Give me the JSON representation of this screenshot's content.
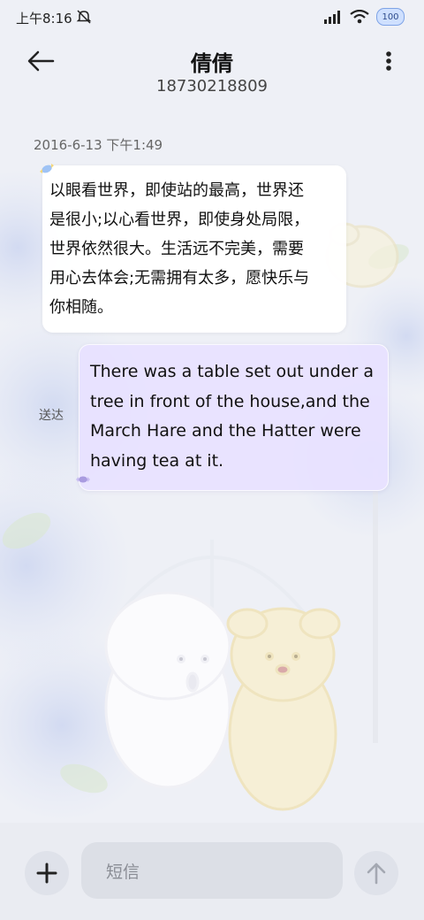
{
  "status_bar": {
    "time": "上午8:16",
    "battery_level": "100",
    "icons": [
      "mute-icon",
      "signal-icon",
      "wifi-icon",
      "battery-icon"
    ]
  },
  "header": {
    "contact_name": "倩倩",
    "phone_number": "18730218809",
    "icons": [
      "back-arrow-icon",
      "more-vert-icon"
    ]
  },
  "conversation": {
    "timestamp": "2016-6-13 下午1:49",
    "messages": [
      {
        "direction": "incoming",
        "lines": [
          "以眼看世界，即使站的最高，世界还",
          "是很小;以心看世界，即使身处局限，",
          "世界依然很大。生活远不完美，需要",
          "用心去体会;无需拥有太多，愿快乐与",
          "你相随。"
        ]
      },
      {
        "direction": "outgoing",
        "status": "送达",
        "lines": [
          "There was a table set out under a",
          "tree in front of the house,and the",
          "March Hare and the Hatter were",
          "having tea at it."
        ]
      }
    ]
  },
  "composer": {
    "placeholder": "短信",
    "icons": [
      "plus-icon",
      "send-arrow-icon"
    ]
  },
  "colors": {
    "outgoing_bubble": "#e8e2ff",
    "incoming_bubble": "#ffffff",
    "background": "#eef0f6"
  }
}
